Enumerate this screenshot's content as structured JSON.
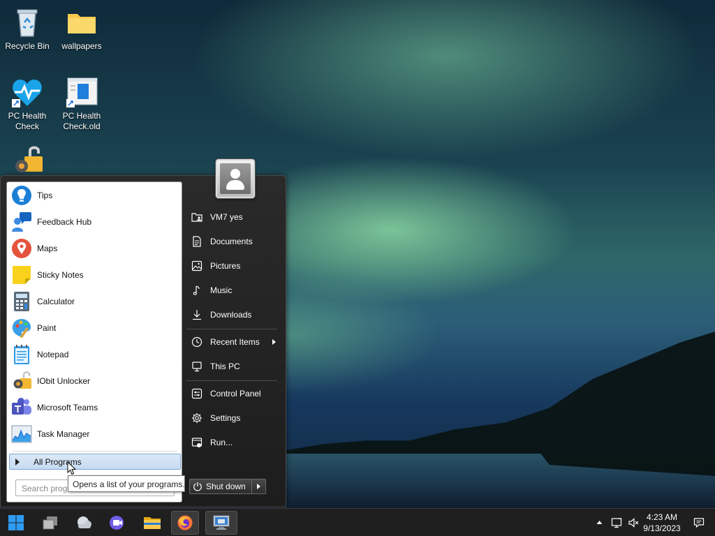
{
  "desktop": {
    "icons": [
      {
        "label": "Recycle Bin"
      },
      {
        "label": "wallpapers"
      },
      {
        "label": "PC Health Check"
      },
      {
        "label": "PC Health Check.old"
      }
    ]
  },
  "start_menu": {
    "programs": [
      {
        "label": "Tips",
        "icon": "tips-icon"
      },
      {
        "label": "Feedback Hub",
        "icon": "feedback-hub-icon"
      },
      {
        "label": "Maps",
        "icon": "maps-icon"
      },
      {
        "label": "Sticky Notes",
        "icon": "sticky-notes-icon"
      },
      {
        "label": "Calculator",
        "icon": "calculator-icon"
      },
      {
        "label": "Paint",
        "icon": "paint-icon"
      },
      {
        "label": "Notepad",
        "icon": "notepad-icon"
      },
      {
        "label": "IObit Unlocker",
        "icon": "iobit-unlocker-icon"
      },
      {
        "label": "Microsoft Teams",
        "icon": "teams-icon"
      },
      {
        "label": "Task Manager",
        "icon": "task-manager-icon"
      }
    ],
    "all_programs": "All Programs",
    "search_placeholder": "Search programs and files",
    "tooltip": "Opens a list of your programs.",
    "right": {
      "user": "VM7 yes",
      "documents": "Documents",
      "pictures": "Pictures",
      "music": "Music",
      "downloads": "Downloads",
      "recent_items": "Recent Items",
      "this_pc": "This PC",
      "control_panel": "Control Panel",
      "settings": "Settings",
      "run": "Run..."
    },
    "shutdown": "Shut down"
  },
  "taskbar": {
    "clock_time": "4:23 AM",
    "clock_date": "9/13/2023"
  },
  "colors": {
    "accent": "#2f7ee6",
    "start_menu_bg": "#1d1d1d",
    "taskbar_bg": "#1f1f1f"
  }
}
